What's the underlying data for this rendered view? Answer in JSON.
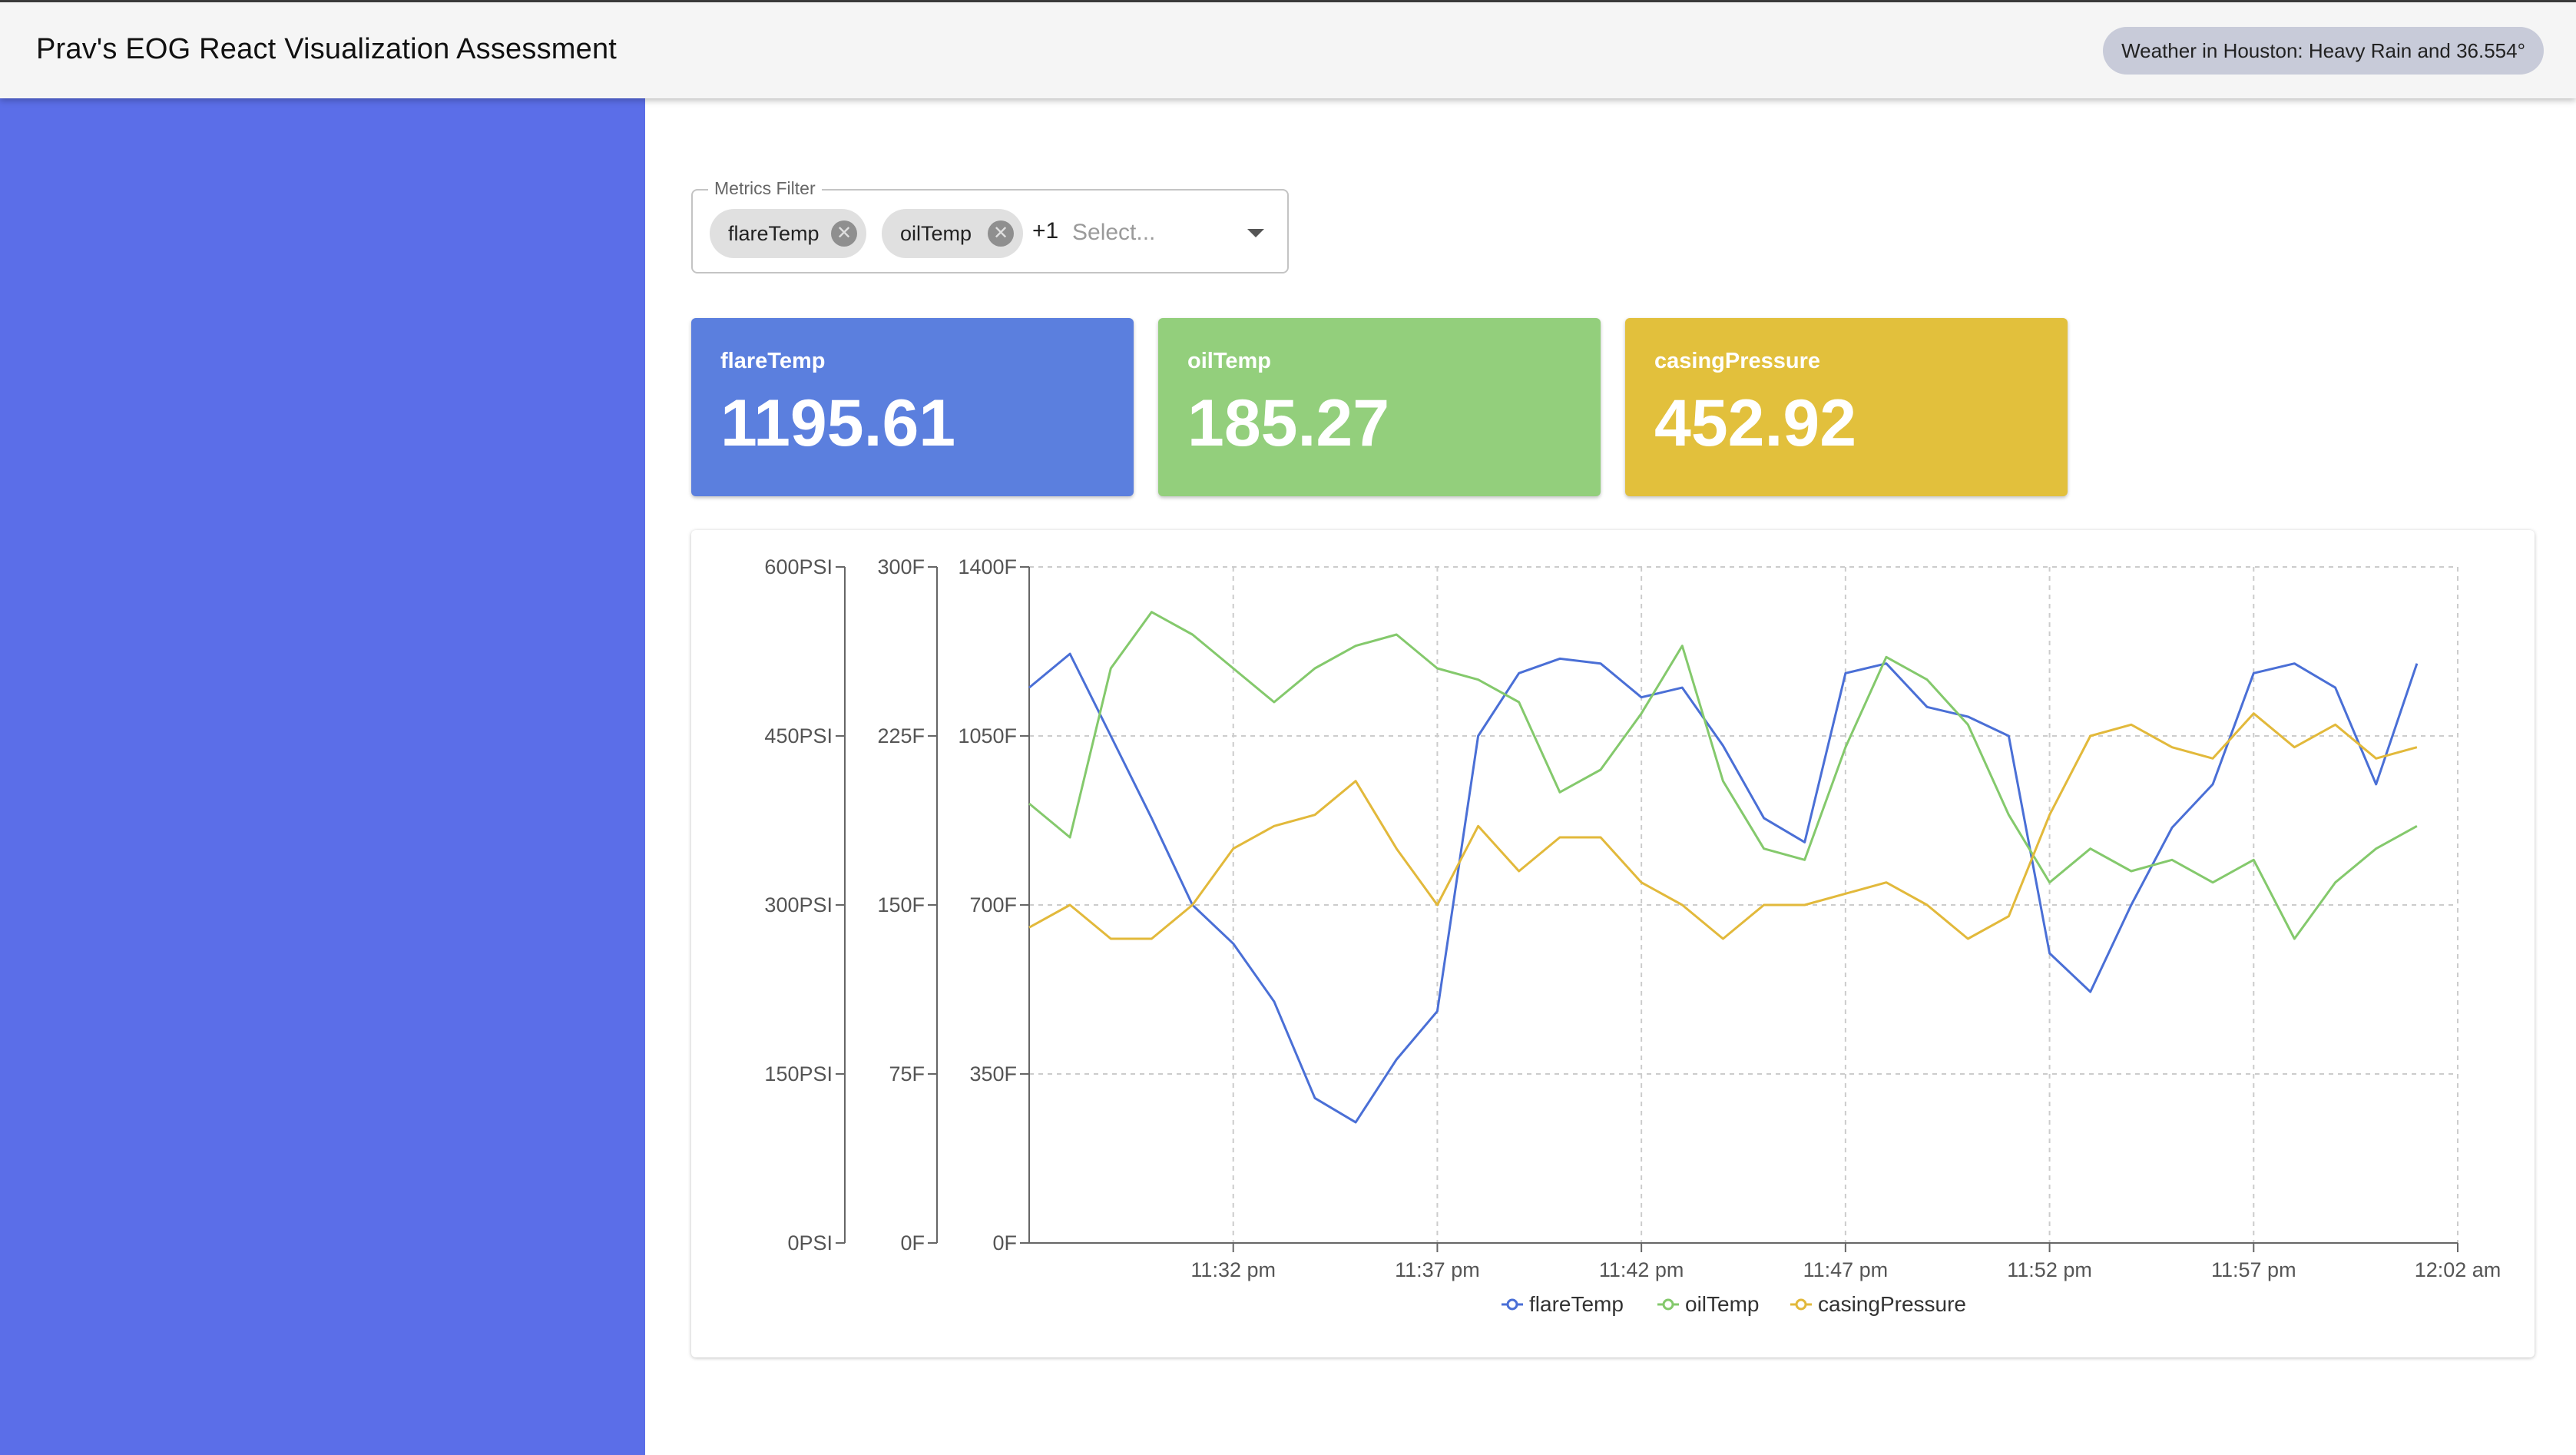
{
  "header": {
    "title": "Prav's EOG React Visualization Assessment",
    "weather": "Weather in Houston: Heavy Rain and 36.554°"
  },
  "filter": {
    "legend": "Metrics Filter",
    "chips": [
      {
        "label": "flareTemp",
        "remove_icon": "close-circle-icon"
      },
      {
        "label": "oilTemp",
        "remove_icon": "close-circle-icon"
      }
    ],
    "more_count": "+1",
    "placeholder": "Select...",
    "dropdown_icon": "caret-down-icon"
  },
  "cards": [
    {
      "metric": "flareTemp",
      "value": "1195.61",
      "color": "#5b7fde"
    },
    {
      "metric": "oilTemp",
      "value": "185.27",
      "color": "#93cf7c"
    },
    {
      "metric": "casingPressure",
      "value": "452.92",
      "color": "#e2c03c"
    }
  ],
  "colors": {
    "sidebar": "#5b6ee8",
    "appbar": "#f5f5f5",
    "weather_chip": "#c8cbd9"
  },
  "chart_data": {
    "type": "line",
    "title": "",
    "grid": true,
    "legend_position": "bottom",
    "x_axis": {
      "type": "time",
      "ticks": [
        "11:32 pm",
        "11:37 pm",
        "11:42 pm",
        "11:47 pm",
        "11:52 pm",
        "11:57 pm",
        "12:02 am"
      ],
      "range": [
        "11:27 pm",
        "12:02 am"
      ]
    },
    "y_axes": [
      {
        "id": "psi",
        "unit": "PSI",
        "range": [
          0,
          600
        ],
        "ticks": [
          "0PSI",
          "150PSI",
          "300PSI",
          "450PSI",
          "600PSI"
        ]
      },
      {
        "id": "f_oil",
        "unit": "F",
        "range": [
          0,
          300
        ],
        "ticks": [
          "0F",
          "75F",
          "150F",
          "225F",
          "300F"
        ]
      },
      {
        "id": "f_flare",
        "unit": "F",
        "range": [
          0,
          1400
        ],
        "ticks": [
          "0F",
          "350F",
          "700F",
          "1050F",
          "1400F"
        ]
      }
    ],
    "series": [
      {
        "name": "flareTemp",
        "color": "#4a6fd6",
        "axis": "f_flare",
        "x": [
          "11:27 pm",
          "11:28 pm",
          "11:29 pm",
          "11:30 pm",
          "11:31 pm",
          "11:32 pm",
          "11:33 pm",
          "11:34 pm",
          "11:35 pm",
          "11:36 pm",
          "11:37 pm",
          "11:38 pm",
          "11:39 pm",
          "11:40 pm",
          "11:41 pm",
          "11:42 pm",
          "11:43 pm",
          "11:44 pm",
          "11:45 pm",
          "11:46 pm",
          "11:47 pm",
          "11:48 pm",
          "11:49 pm",
          "11:50 pm",
          "11:51 pm",
          "11:52 pm",
          "11:53 pm",
          "11:54 pm",
          "11:55 pm",
          "11:56 pm",
          "11:57 pm",
          "11:58 pm",
          "11:59 pm",
          "12:00 am",
          "12:01 am"
        ],
        "values": [
          1150,
          1220,
          1050,
          880,
          700,
          620,
          500,
          300,
          250,
          380,
          480,
          1050,
          1180,
          1210,
          1200,
          1130,
          1150,
          1030,
          880,
          830,
          1180,
          1200,
          1110,
          1090,
          1050,
          600,
          520,
          700,
          860,
          950,
          1180,
          1200,
          1150,
          950,
          1200
        ]
      },
      {
        "name": "oilTemp",
        "color": "#84c96c",
        "axis": "f_oil",
        "x": [
          "11:27 pm",
          "11:28 pm",
          "11:29 pm",
          "11:30 pm",
          "11:31 pm",
          "11:32 pm",
          "11:33 pm",
          "11:34 pm",
          "11:35 pm",
          "11:36 pm",
          "11:37 pm",
          "11:38 pm",
          "11:39 pm",
          "11:40 pm",
          "11:41 pm",
          "11:42 pm",
          "11:43 pm",
          "11:44 pm",
          "11:45 pm",
          "11:46 pm",
          "11:47 pm",
          "11:48 pm",
          "11:49 pm",
          "11:50 pm",
          "11:51 pm",
          "11:52 pm",
          "11:53 pm",
          "11:54 pm",
          "11:55 pm",
          "11:56 pm",
          "11:57 pm",
          "11:58 pm",
          "11:59 pm",
          "12:00 am",
          "12:01 am"
        ],
        "values": [
          195,
          180,
          255,
          280,
          270,
          255,
          240,
          255,
          265,
          270,
          255,
          250,
          240,
          200,
          210,
          235,
          265,
          205,
          175,
          170,
          220,
          260,
          250,
          230,
          190,
          160,
          175,
          165,
          170,
          160,
          170,
          135,
          160,
          175,
          185
        ]
      },
      {
        "name": "casingPressure",
        "color": "#e2b93b",
        "axis": "psi",
        "x": [
          "11:27 pm",
          "11:28 pm",
          "11:29 pm",
          "11:30 pm",
          "11:31 pm",
          "11:32 pm",
          "11:33 pm",
          "11:34 pm",
          "11:35 pm",
          "11:36 pm",
          "11:37 pm",
          "11:38 pm",
          "11:39 pm",
          "11:40 pm",
          "11:41 pm",
          "11:42 pm",
          "11:43 pm",
          "11:44 pm",
          "11:45 pm",
          "11:46 pm",
          "11:47 pm",
          "11:48 pm",
          "11:49 pm",
          "11:50 pm",
          "11:51 pm",
          "11:52 pm",
          "11:53 pm",
          "11:54 pm",
          "11:55 pm",
          "11:56 pm",
          "11:57 pm",
          "11:58 pm",
          "11:59 pm",
          "12:00 am",
          "12:01 am"
        ],
        "values": [
          280,
          300,
          270,
          270,
          300,
          350,
          370,
          380,
          410,
          350,
          300,
          370,
          330,
          360,
          360,
          320,
          300,
          270,
          300,
          300,
          310,
          320,
          300,
          270,
          290,
          380,
          450,
          460,
          440,
          430,
          470,
          440,
          460,
          430,
          440
        ]
      }
    ]
  }
}
